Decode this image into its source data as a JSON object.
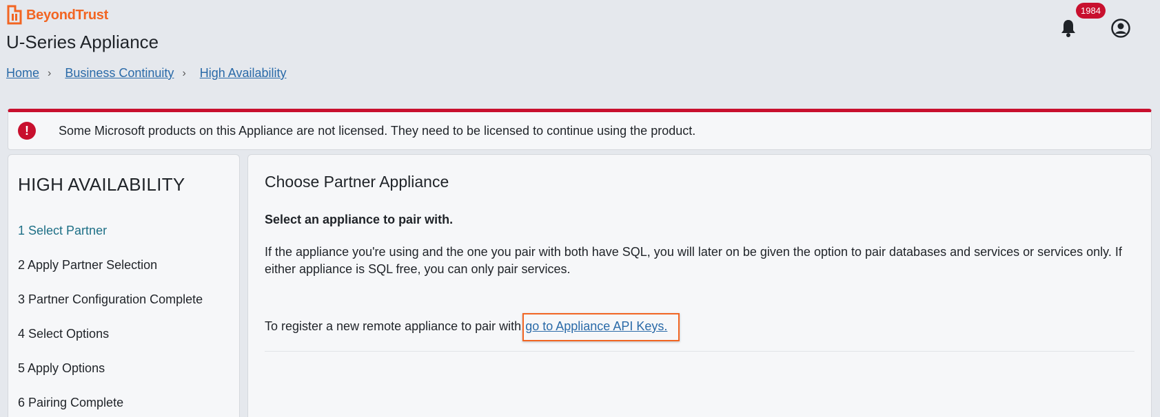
{
  "brand": {
    "name": "BeyondTrust",
    "accent": "#f26522"
  },
  "header": {
    "app_title": "U-Series Appliance",
    "notification_count": "1984"
  },
  "breadcrumb": [
    "Home",
    "Business Continuity",
    "High Availability"
  ],
  "alert": {
    "message": "Some Microsoft products on this Appliance are not licensed. They need to be licensed to continue using the product.",
    "color": "#c8102e"
  },
  "sidebar": {
    "title": "HIGH AVAILABILITY",
    "steps": [
      {
        "label": "1 Select Partner",
        "active": true
      },
      {
        "label": "2 Apply Partner Selection",
        "active": false
      },
      {
        "label": "3 Partner Configuration Complete",
        "active": false
      },
      {
        "label": "4 Select Options",
        "active": false
      },
      {
        "label": "5 Apply Options",
        "active": false
      },
      {
        "label": "6 Pairing Complete",
        "active": false
      }
    ]
  },
  "main": {
    "title": "Choose Partner Appliance",
    "subtitle": "Select an appliance to pair with.",
    "description": "If the appliance you're using and the one you pair with both have SQL, you will later on be given the option to pair databases and services or services only. If either appliance is SQL free, you can only pair services.",
    "register_text": "To register a new remote appliance to pair with,",
    "register_link": "go to Appliance API Keys."
  }
}
